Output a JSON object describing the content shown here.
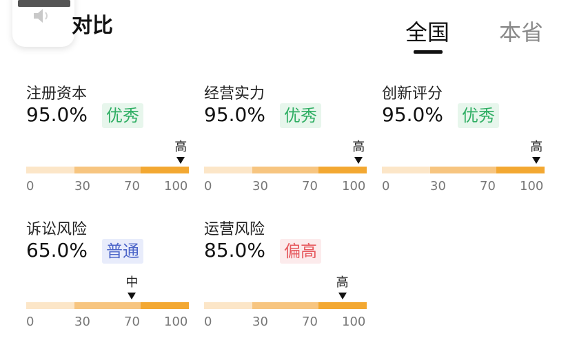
{
  "header": {
    "title": "对比",
    "tabs": [
      {
        "label": "全国",
        "active": true
      },
      {
        "label": "本省",
        "active": false
      }
    ]
  },
  "scale": {
    "ticks": [
      "0",
      "30",
      "70",
      "100"
    ]
  },
  "metrics": [
    {
      "name": "注册资本",
      "percent": "95.0%",
      "badge": "优秀",
      "badge_type": "good",
      "level": "高",
      "marker_value": 95
    },
    {
      "name": "经营实力",
      "percent": "95.0%",
      "badge": "优秀",
      "badge_type": "good",
      "level": "高",
      "marker_value": 95
    },
    {
      "name": "创新评分",
      "percent": "95.0%",
      "badge": "优秀",
      "badge_type": "good",
      "level": "高",
      "marker_value": 95
    },
    {
      "name": "诉讼风险",
      "percent": "65.0%",
      "badge": "普通",
      "badge_type": "normal",
      "level": "中",
      "marker_value": 65
    },
    {
      "name": "运营风险",
      "percent": "85.0%",
      "badge": "偏高",
      "badge_type": "high",
      "level": "高",
      "marker_value": 85
    }
  ],
  "colors": {
    "segment_low": "#fce6c8",
    "segment_mid": "#f7c580",
    "segment_high": "#f3a832",
    "badge_good": "#2fae63",
    "badge_normal": "#4d66c9",
    "badge_high": "#e65a5f"
  },
  "icons": {
    "speaker": "speaker-icon"
  }
}
